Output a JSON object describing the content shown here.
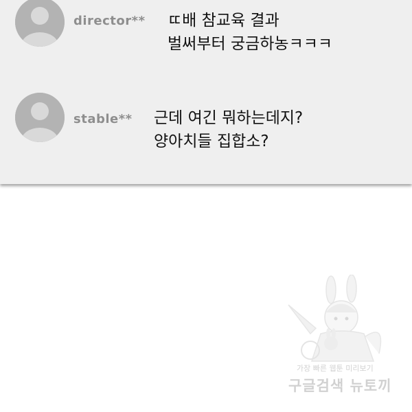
{
  "comments": [
    {
      "username": "director**",
      "lines": [
        "ㄸ배 참교육 결과",
        "벌써부터 궁금하농ㅋㅋㅋ"
      ],
      "avatar_icon": "default-avatar-icon"
    },
    {
      "username": "stable**",
      "lines": [
        "근데 여긴 뭐하는데지?",
        "양아치들 집합소?"
      ],
      "avatar_icon": "default-avatar-icon"
    }
  ],
  "watermark": {
    "tagline": "가장 빠른 웹툰 미리보기",
    "brand": "구글검색 뉴토끼",
    "mascot": "bunny-girl-mascot"
  },
  "colors": {
    "panel_bg": "#efefef",
    "avatar_bg": "#b3b3b3",
    "avatar_fg": "#d9d9d9",
    "username": "#8e8e8e",
    "text": "#111111"
  }
}
